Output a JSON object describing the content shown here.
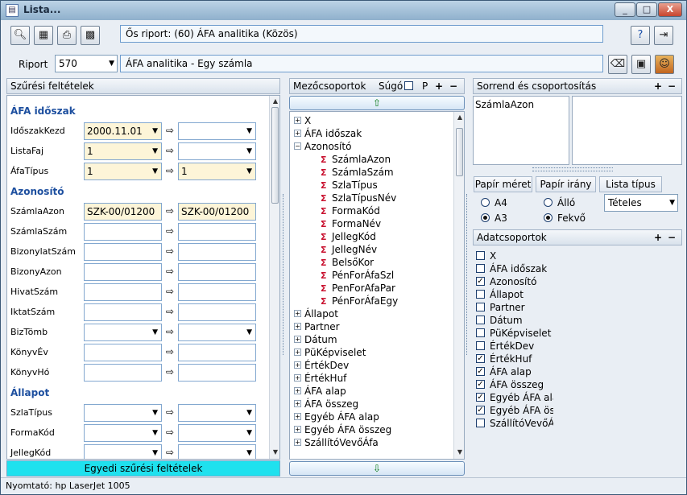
{
  "window": {
    "title": "Lista...",
    "min": "_",
    "max": "□",
    "close": "X"
  },
  "toolbar": {
    "origin_report": "Ős riport: (60)  ÁFA analitika (Közös)"
  },
  "report": {
    "label": "Riport",
    "id": "570",
    "name": "ÁFA analitika - Egy számla"
  },
  "filters": {
    "header": "Szűrési feltételek",
    "bottom_button": "Egyedi szűrési feltételek",
    "sections": [
      {
        "title": "ÁFA időszak"
      },
      {
        "title": "Azonosító"
      },
      {
        "title": "Állapot"
      }
    ],
    "rows": [
      {
        "label": "IdőszakKezd",
        "from": "2000.11.01",
        "to": ""
      },
      {
        "label": "ListaFaj",
        "from": "1",
        "to": ""
      },
      {
        "label": "ÁfaTípus",
        "from": "1",
        "to": "1"
      },
      {
        "label": "SzámlaAzon",
        "from": "SZK-00/01200",
        "to": "SZK-00/01200"
      },
      {
        "label": "SzámlaSzám",
        "from": "",
        "to": ""
      },
      {
        "label": "BizonylatSzám",
        "from": "",
        "to": ""
      },
      {
        "label": "BizonyAzon",
        "from": "",
        "to": ""
      },
      {
        "label": "HivatSzám",
        "from": "",
        "to": ""
      },
      {
        "label": "IktatSzám",
        "from": "",
        "to": ""
      },
      {
        "label": "BizTömb",
        "from": "",
        "to": ""
      },
      {
        "label": "KönyvÉv",
        "from": "",
        "to": ""
      },
      {
        "label": "KönyvHó",
        "from": "",
        "to": ""
      },
      {
        "label": "SzlaTípus",
        "from": "",
        "to": ""
      },
      {
        "label": "FormaKód",
        "from": "",
        "to": ""
      },
      {
        "label": "JellegKód",
        "from": "",
        "to": ""
      }
    ],
    "arrow": "⇨"
  },
  "fieldgroups": {
    "header": "Mezőcsoportok",
    "help_label": "Súgó",
    "p_label": "P",
    "plus": "+",
    "minus": "−",
    "tree": [
      {
        "label": "X",
        "exp": "+"
      },
      {
        "label": "ÁFA időszak",
        "exp": "+"
      },
      {
        "label": "Azonosító",
        "exp": "−"
      },
      {
        "label": "SzámlaAzon",
        "leaf": true
      },
      {
        "label": "SzámlaSzám",
        "leaf": true
      },
      {
        "label": "SzlaTípus",
        "leaf": true
      },
      {
        "label": "SzlaTípusNév",
        "leaf": true
      },
      {
        "label": "FormaKód",
        "leaf": true
      },
      {
        "label": "FormaNév",
        "leaf": true
      },
      {
        "label": "JellegKód",
        "leaf": true
      },
      {
        "label": "JellegNév",
        "leaf": true
      },
      {
        "label": "BelsőKor",
        "leaf": true
      },
      {
        "label": "PénForÁfaSzl",
        "leaf": true
      },
      {
        "label": "PenForAfaPar",
        "leaf": true
      },
      {
        "label": "PénForÁfaEgy",
        "leaf": true
      },
      {
        "label": "Állapot",
        "exp": "+"
      },
      {
        "label": "Partner",
        "exp": "+"
      },
      {
        "label": "Dátum",
        "exp": "+"
      },
      {
        "label": "PüKépviselet",
        "exp": "+"
      },
      {
        "label": "ÉrtékDev",
        "exp": "+"
      },
      {
        "label": "ÉrtékHuf",
        "exp": "+"
      },
      {
        "label": "ÁFA alap",
        "exp": "+"
      },
      {
        "label": "ÁFA összeg",
        "exp": "+"
      },
      {
        "label": "Egyéb ÁFA alap",
        "exp": "+"
      },
      {
        "label": "Egyéb ÁFA összeg",
        "exp": "+"
      },
      {
        "label": "SzállítóVevőÁfa",
        "exp": "+"
      }
    ]
  },
  "sorting": {
    "header": "Sorrend és csoportosítás",
    "plus": "+",
    "minus": "−",
    "items": [
      "SzámlaAzon"
    ]
  },
  "paper": {
    "size_label": "Papír méret",
    "orient_label": "Papír irány",
    "list_type_label": "Lista típus",
    "a4": "A4",
    "a3": "A3",
    "portrait": "Álló",
    "landscape": "Fekvő",
    "size_selected": "A3",
    "orient_selected": "Fekvő",
    "list_type": "Tételes"
  },
  "datagroups": {
    "header": "Adatcsoportok",
    "plus": "+",
    "minus": "−",
    "items": [
      {
        "label": "X",
        "checked": false
      },
      {
        "label": "ÁFA időszak",
        "checked": false
      },
      {
        "label": "Azonosító",
        "checked": true
      },
      {
        "label": "Állapot",
        "checked": false
      },
      {
        "label": "Partner",
        "checked": false
      },
      {
        "label": "Dátum",
        "checked": false
      },
      {
        "label": "PüKépviselet",
        "checked": false
      },
      {
        "label": "ÉrtékDev",
        "checked": false
      },
      {
        "label": "ÉrtékHuf",
        "checked": true
      },
      {
        "label": "ÁFA alap",
        "checked": true
      },
      {
        "label": "ÁFA összeg",
        "checked": true
      },
      {
        "label": "Egyéb ÁFA alap",
        "checked": true
      },
      {
        "label": "Egyéb ÁFA összeg",
        "checked": true
      },
      {
        "label": "SzállítóVevőÁfa",
        "checked": false
      }
    ]
  },
  "status": {
    "printer": "Nyomtató: hp LaserJet 1005"
  }
}
